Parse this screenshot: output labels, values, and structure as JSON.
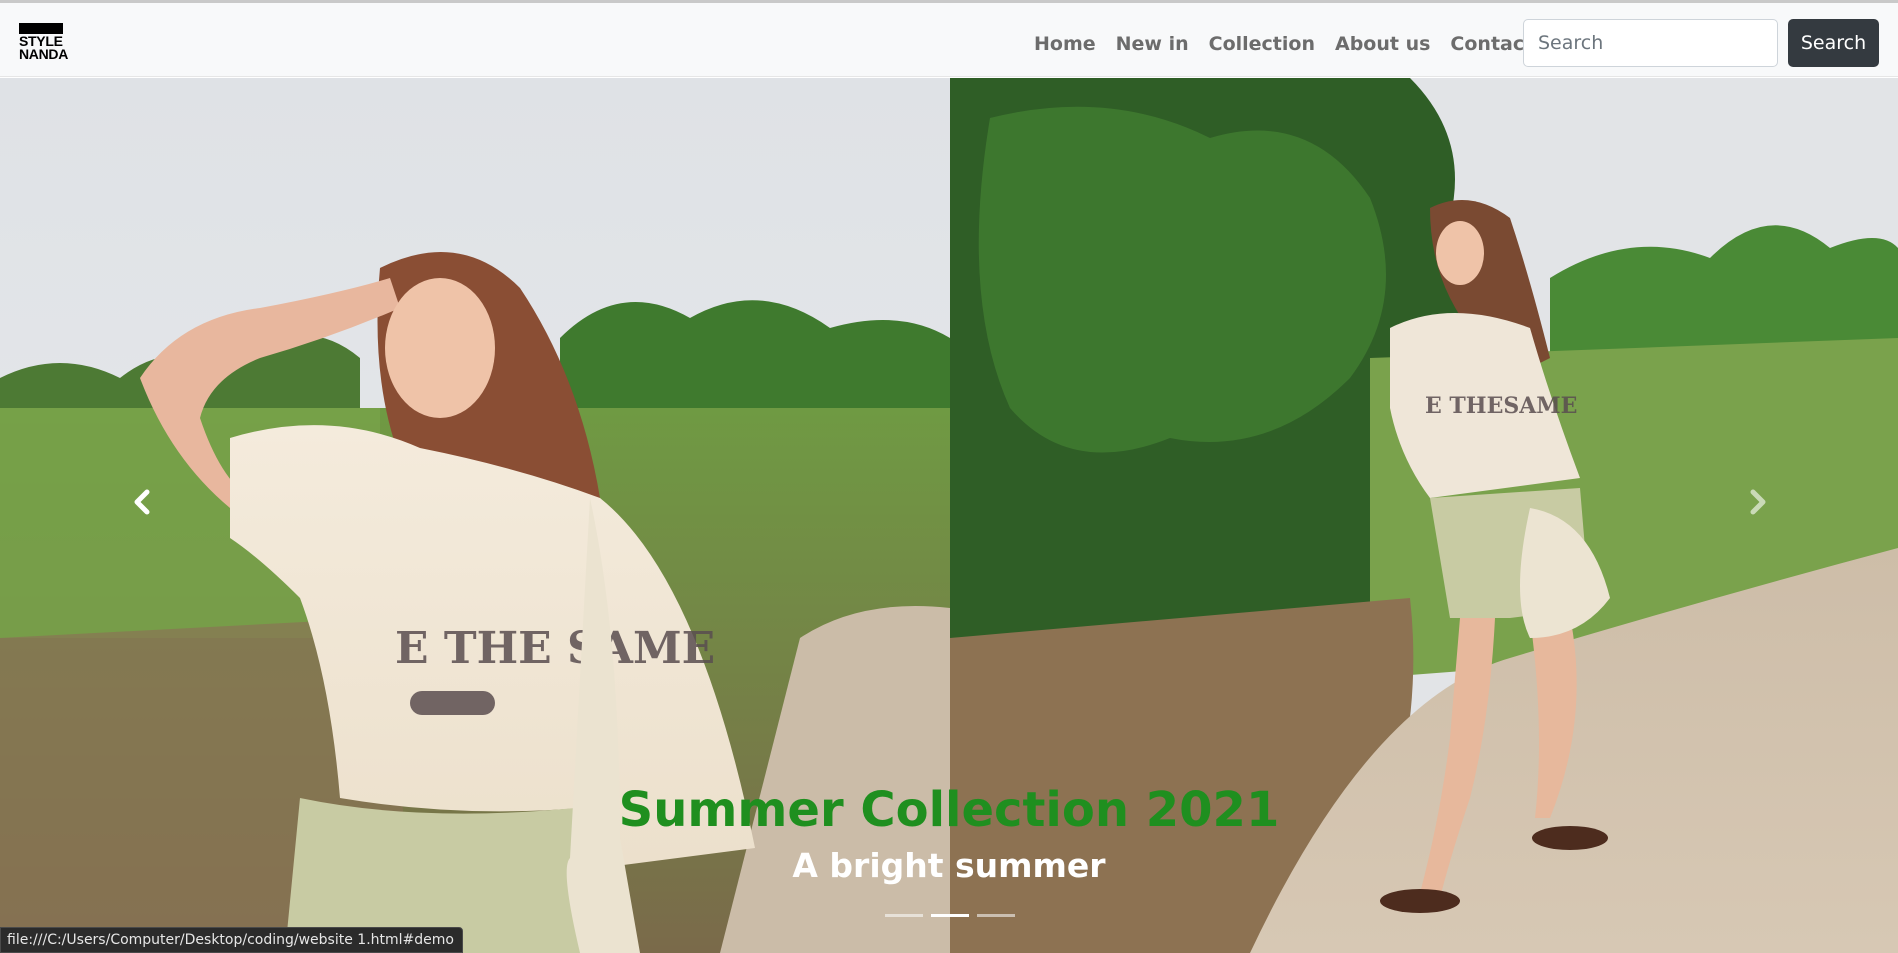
{
  "brand": {
    "line1": "STYLE",
    "line2": "NANDA"
  },
  "nav": {
    "items": [
      {
        "label": "Home"
      },
      {
        "label": "New in"
      },
      {
        "label": "Collection"
      },
      {
        "label": "About us"
      },
      {
        "label": "Contact us"
      }
    ]
  },
  "search": {
    "placeholder": "Search",
    "button_label": "Search"
  },
  "carousel": {
    "caption_title": "Summer Collection 2021",
    "caption_subtitle": "A bright summer",
    "active_index": 1,
    "indicator_count": 3,
    "prev_icon": "chevron-left-icon",
    "next_icon": "chevron-right-icon"
  },
  "status_bar": {
    "url": "file:///C:/Users/Computer/Desktop/coding/website 1.html#demo"
  },
  "colors": {
    "caption_title": "#1f8f1f",
    "search_button": "#343a40",
    "nav_text": "#6c6c6c"
  }
}
